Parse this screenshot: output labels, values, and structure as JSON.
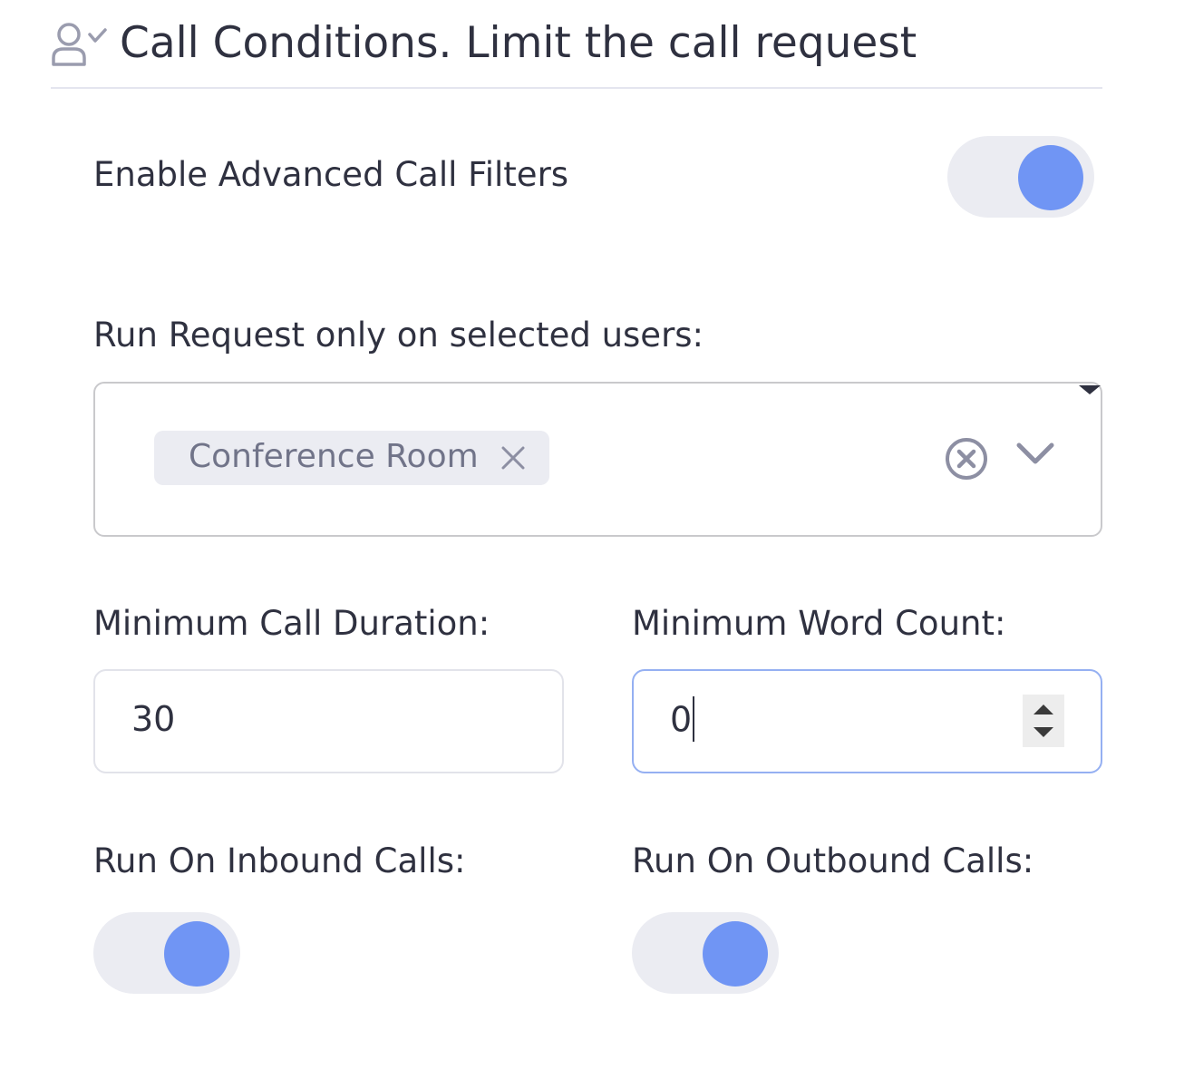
{
  "header": {
    "title": "Call Conditions. Limit the call request",
    "icon": "user-check-icon"
  },
  "advanced_filters": {
    "label": "Enable Advanced Call Filters",
    "enabled": true
  },
  "users_select": {
    "label": "Run Request only on selected users:",
    "selected": [
      "Conference Room"
    ],
    "clear_icon": "clear-circle-icon",
    "dropdown_icon": "chevron-down-icon"
  },
  "min_duration": {
    "label": "Minimum Call Duration:",
    "value": "30"
  },
  "min_word_count": {
    "label": "Minimum Word Count:",
    "value": "0"
  },
  "inbound": {
    "label": "Run On Inbound Calls:",
    "enabled": true
  },
  "outbound": {
    "label": "Run On Outbound Calls:",
    "enabled": true
  },
  "colors": {
    "accent": "#7095f4",
    "toggle_track": "#ebecf2",
    "text": "#2f3140",
    "muted_text": "#717489",
    "focus_border": "#95b0f2"
  }
}
